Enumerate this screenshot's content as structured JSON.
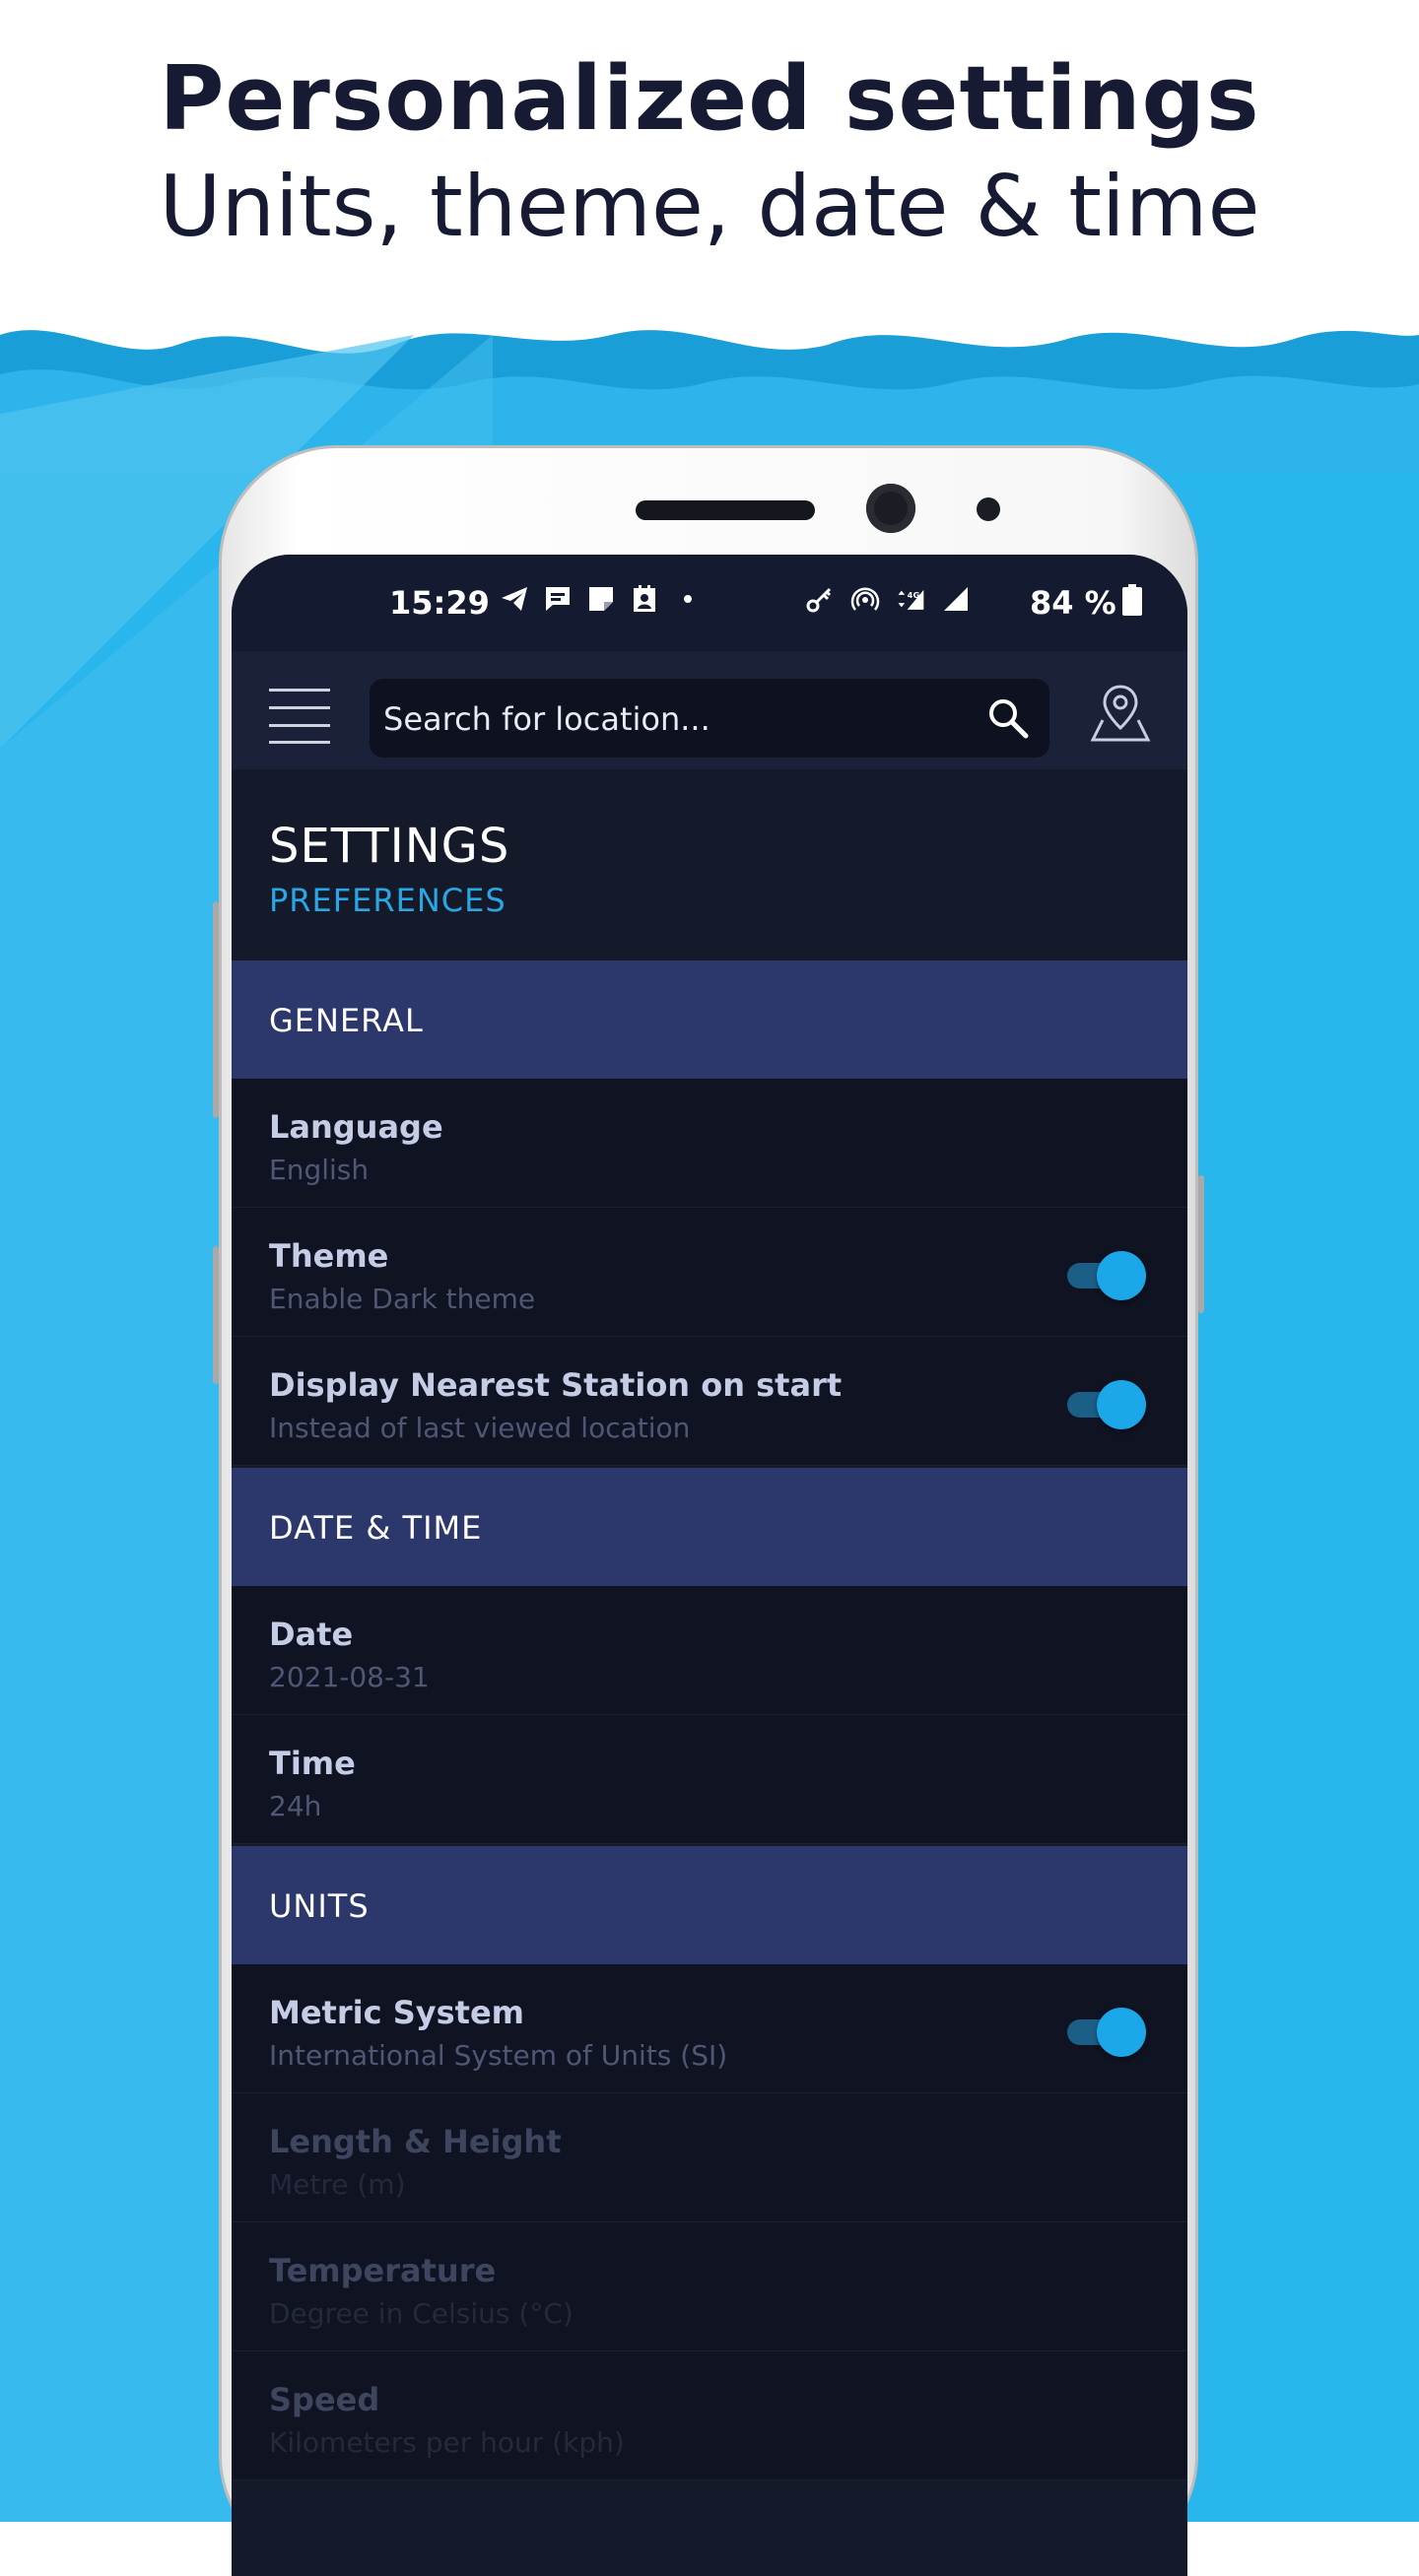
{
  "hero": {
    "title": "Personalized settings",
    "subtitle": "Units, theme, date & time"
  },
  "colors": {
    "accent": "#29a7e5",
    "section_bg": "#2c376b",
    "row_bg": "#0f1322",
    "toggle_on": "#1ba7e8",
    "wave_blue": "#28b4ea"
  },
  "status_bar": {
    "time": "15:29",
    "left_icons": [
      "telegram-icon",
      "message-icon",
      "note-icon",
      "contact-icon",
      "dot-icon"
    ],
    "right_icons": [
      "key-icon",
      "hotspot-icon",
      "data-4g-icon",
      "signal-icon"
    ],
    "battery_text": "84 %",
    "battery_icon": "battery-icon"
  },
  "top_bar": {
    "search_placeholder": "Search for location...",
    "menu_icon": "hamburger-icon",
    "search_icon": "search-icon",
    "location_icon": "map-pin-icon"
  },
  "page": {
    "title": "SETTINGS",
    "subtitle": "PREFERENCES"
  },
  "sections": {
    "general": {
      "header": "GENERAL",
      "language": {
        "title": "Language",
        "value": "English"
      },
      "theme": {
        "title": "Theme",
        "value": "Enable Dark theme",
        "toggle": true
      },
      "nearest": {
        "title": "Display Nearest Station on start",
        "value": "Instead of last viewed location",
        "toggle": true
      }
    },
    "datetime": {
      "header": "DATE & TIME",
      "date": {
        "title": "Date",
        "value": "2021-08-31"
      },
      "time": {
        "title": "Time",
        "value": "24h"
      }
    },
    "units": {
      "header": "UNITS",
      "metric": {
        "title": "Metric System",
        "value": "International System of Units (SI)",
        "toggle": true
      },
      "length": {
        "title": "Length & Height",
        "value": "Metre (m)"
      },
      "temperature": {
        "title": "Temperature",
        "value": "Degree in Celsius (°C)"
      },
      "speed": {
        "title": "Speed",
        "value": "Kilometers per hour (kph)"
      }
    }
  }
}
